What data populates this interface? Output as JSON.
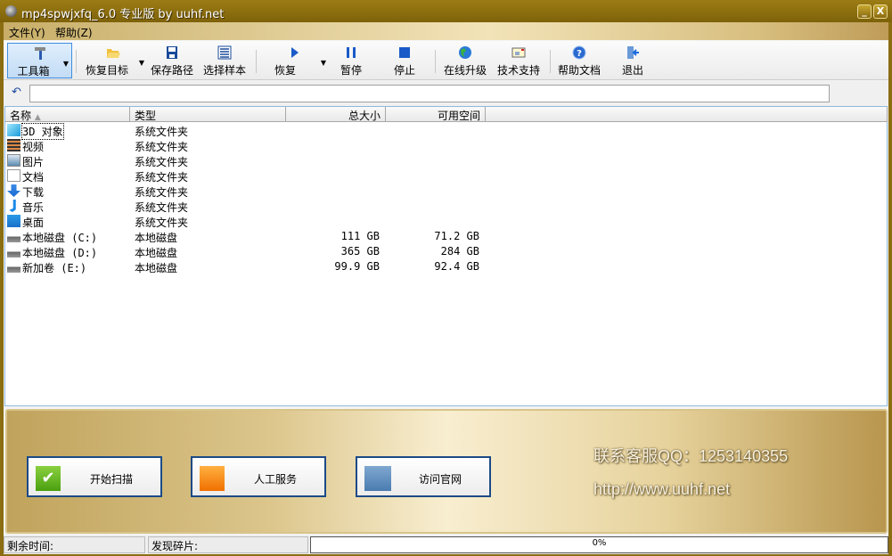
{
  "window": {
    "title": "mp4spwjxfq_6.0 专业版 by uuhf.net",
    "minimize": "_",
    "close": "X"
  },
  "menu": [
    "文件(Y)",
    "帮助(Z)"
  ],
  "toolbar": [
    {
      "label": "工具箱",
      "icon": "hammer-icon"
    },
    {
      "label": "恢复目标",
      "icon": "folder-open-icon"
    },
    {
      "label": "保存路径",
      "icon": "save-icon"
    },
    {
      "label": "选择样本",
      "icon": "list-icon"
    },
    {
      "label": "恢复",
      "icon": "play-icon"
    },
    {
      "label": "暂停",
      "icon": "pause-icon"
    },
    {
      "label": "停止",
      "icon": "stop-icon"
    },
    {
      "label": "在线升级",
      "icon": "globe-icon"
    },
    {
      "label": "技术支持",
      "icon": "mail-icon"
    },
    {
      "label": "帮助文档",
      "icon": "help-icon"
    },
    {
      "label": "退出",
      "icon": "exit-icon"
    }
  ],
  "address": {
    "value": ""
  },
  "list": {
    "columns": [
      "名称",
      "类型",
      "总大小",
      "可用空间"
    ],
    "rows": [
      {
        "name": "3D 对象",
        "type": "系统文件夹",
        "size": "",
        "free": "",
        "icon": "3d-objects-icon"
      },
      {
        "name": "视频",
        "type": "系统文件夹",
        "size": "",
        "free": "",
        "icon": "video-icon"
      },
      {
        "name": "图片",
        "type": "系统文件夹",
        "size": "",
        "free": "",
        "icon": "picture-icon"
      },
      {
        "name": "文档",
        "type": "系统文件夹",
        "size": "",
        "free": "",
        "icon": "document-icon"
      },
      {
        "name": "下载",
        "type": "系统文件夹",
        "size": "",
        "free": "",
        "icon": "download-icon"
      },
      {
        "name": "音乐",
        "type": "系统文件夹",
        "size": "",
        "free": "",
        "icon": "music-icon"
      },
      {
        "name": "桌面",
        "type": "系统文件夹",
        "size": "",
        "free": "",
        "icon": "desktop-icon"
      },
      {
        "name": "本地磁盘 (C:)",
        "type": "本地磁盘",
        "size": "111 GB",
        "free": "71.2 GB",
        "icon": "drive-icon"
      },
      {
        "name": "本地磁盘 (D:)",
        "type": "本地磁盘",
        "size": "365 GB",
        "free": "284 GB",
        "icon": "drive-icon"
      },
      {
        "name": "新加卷 (E:)",
        "type": "本地磁盘",
        "size": "99.9 GB",
        "free": "92.4 GB",
        "icon": "drive-icon"
      }
    ]
  },
  "panel": {
    "buttons": [
      "开始扫描",
      "人工服务",
      "访问官网"
    ],
    "qq": "联系客服QQ：1253140355",
    "url": "http://www.uuhf.net"
  },
  "status": {
    "remaining": "剩余时间:",
    "fragments": "发现碎片:",
    "progress": "0%",
    "progress_value": 0
  }
}
